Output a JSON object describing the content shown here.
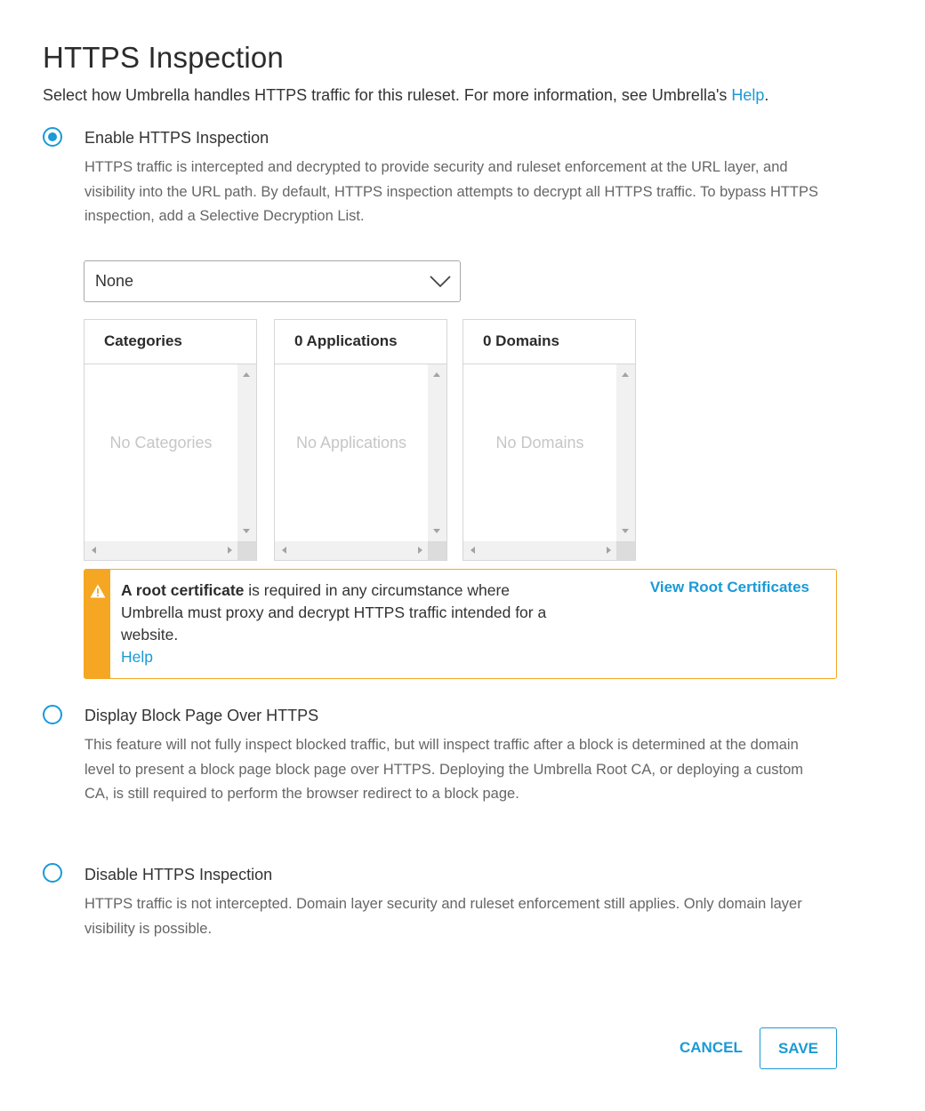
{
  "page": {
    "title": "HTTPS Inspection",
    "intro_text": "Select how Umbrella handles HTTPS traffic for this ruleset. For more information, see Umbrella's ",
    "intro_link": "Help",
    "intro_suffix": "."
  },
  "options": [
    {
      "label": "Enable HTTPS Inspection",
      "selected": true,
      "description": "HTTPS traffic is intercepted and decrypted to provide security and ruleset enforcement at the URL layer, and visibility into the URL path. By default, HTTPS inspection attempts to decrypt all HTTPS traffic. To bypass HTTPS inspection, add a Selective Decryption List."
    },
    {
      "label": "Display Block Page Over HTTPS",
      "selected": false,
      "description": "This feature will not fully inspect blocked traffic, but will inspect traffic after a block is determined at the domain level to present a block page block page over HTTPS. Deploying the Umbrella Root CA, or deploying a custom CA, is still required to perform the browser redirect to a block page."
    },
    {
      "label": "Disable HTTPS Inspection",
      "selected": false,
      "description": "HTTPS traffic is not intercepted. Domain layer security and ruleset enforcement still applies. Only domain layer visibility is possible."
    }
  ],
  "decryption_list": {
    "selected": "None",
    "icon": "chevron-down-icon"
  },
  "lists": [
    {
      "header": "Categories",
      "empty": "No Categories"
    },
    {
      "header": "0 Applications",
      "empty": "No Applications"
    },
    {
      "header": "0 Domains",
      "empty": "No Domains"
    }
  ],
  "alert": {
    "icon": "warning-icon",
    "bold": "A root certificate",
    "text": " is required in any circumstance where Umbrella must proxy and decrypt HTTPS traffic intended for a website.",
    "help_link": "Help",
    "action": "View Root Certificates"
  },
  "footer": {
    "cancel": "CANCEL",
    "save": "SAVE"
  },
  "colors": {
    "accent": "#1a9ad6",
    "warning": "#f5a623"
  }
}
